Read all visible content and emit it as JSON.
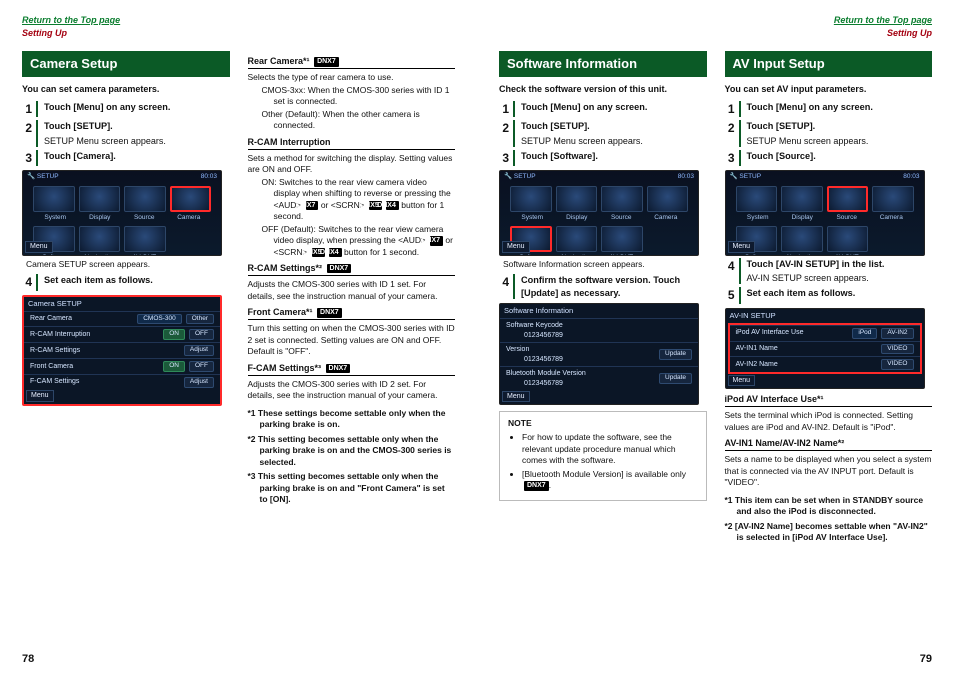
{
  "top": {
    "return_link": "Return to the Top page",
    "section": "Setting Up"
  },
  "page78": {
    "num": "78"
  },
  "page79": {
    "num": "79"
  },
  "screen_labels": {
    "system": "System",
    "display": "Display",
    "source": "Source",
    "camera": "Camera",
    "software": "Software",
    "navigation": "Navigation",
    "avout": "AV-OUT",
    "setup_tag": "SETUP",
    "menu": "Menu",
    "time": "80:03"
  },
  "camera": {
    "title": "Camera Setup",
    "lead": "You can set camera parameters.",
    "s1": "Touch [Menu] on any screen.",
    "s2": "Touch [SETUP].",
    "s2d": "SETUP Menu screen appears.",
    "s3": "Touch [Camera].",
    "cap1": "Camera SETUP screen appears.",
    "s4": "Set each item as follows.",
    "list": {
      "title": "Camera SETUP",
      "r1": "Rear Camera",
      "r1a": "CMOS-300",
      "r1b": "Other",
      "r2": "R-CAM Interruption",
      "r2a": "ON",
      "r2b": "OFF",
      "r3": "R-CAM Settings",
      "r3a": "Adjust",
      "r4": "Front Camera",
      "r4a": "ON",
      "r4b": "OFF",
      "r5": "F-CAM Settings",
      "r5a": "Adjust"
    }
  },
  "camera_defs": {
    "d1h": "Rear Camera*¹",
    "d1": "Selects the type of rear camera to use.",
    "d1a": "CMOS-3xx",
    "d1at": "When the CMOS-300 series with ID 1 set is connected.",
    "d1b": "Other (Default)",
    "d1bt": "When the other camera is connected.",
    "d2h": "R-CAM Interruption",
    "d2": "Sets a method for switching the display. Setting values are ON and OFF.",
    "d2a": "ON",
    "d2at": "Switches to the rear view camera video display when shifting to reverse or pressing the <AUD>",
    "d2at2": "or <SCRN>",
    "d2at3": "button for 1 second.",
    "d2b": "OFF (Default)",
    "d2bt": "Switches to the rear view camera video display, when pressing the <AUD>",
    "d2bt2": "or <SCRN>",
    "d2bt3": "button for 1 second.",
    "d3h": "R-CAM Settings*²",
    "d3": "Adjusts the CMOS-300 series with ID 1 set. For details, see the instruction manual of your camera.",
    "d4h": "Front Camera*¹",
    "d4": "Turn this setting on when the CMOS-300 series with ID 2 set is connected. Setting values are ON and OFF. Default is \"OFF\".",
    "d5h": "F-CAM Settings*³",
    "d5": "Adjusts the CMOS-300 series with ID 2 set. For details, see the instruction manual of your camera.",
    "foot1": "*1 These settings become settable only when the parking brake is on.",
    "foot2": "*2 This setting becomes settable only when the parking brake is on and the CMOS-300 series is selected.",
    "foot3": "*3 This setting becomes settable only when the parking brake is on and \"Front Camera\" is set to [ON].",
    "badge7": "DNX7",
    "badge5": "DNX5",
    "badge4": "DNX4"
  },
  "sw": {
    "title": "Software Information",
    "lead": "Check the software version of this unit.",
    "s1": "Touch [Menu] on any screen.",
    "s2": "Touch [SETUP].",
    "s2d": "SETUP Menu screen appears.",
    "s3": "Touch [Software].",
    "cap1": "Software Information screen appears.",
    "s4": "Confirm the software version. Touch [Update] as necessary.",
    "list": {
      "title": "Software Information",
      "r1": "Software Keycode",
      "r1v": "0123456789",
      "r2": "Version",
      "r2v": "0123456789",
      "upd": "Update",
      "r3": "Bluetooth Module Version",
      "r3v": "0123456789"
    },
    "note_label": "NOTE",
    "note1": "For how to update the software, see the relevant update procedure manual which comes with the software.",
    "note2": "[Bluetooth Module Version] is available only"
  },
  "av": {
    "title": "AV Input Setup",
    "lead": "You can set AV input parameters.",
    "s1": "Touch [Menu] on any screen.",
    "s2": "Touch [SETUP].",
    "s2d": "SETUP Menu screen appears.",
    "s3": "Touch [Source].",
    "s4": "Touch [AV-IN SETUP] in the list.",
    "s4d": "AV-IN SETUP screen appears.",
    "s5": "Set each item as follows.",
    "list": {
      "title": "AV-IN SETUP",
      "r1": "iPod AV Interface Use",
      "r1a": "iPod",
      "r1b": "AV-IN2",
      "r2": "AV-IN1 Name",
      "r2a": "VIDEO",
      "r3": "AV-IN2 Name",
      "r3a": "VIDEO"
    },
    "d1h": "iPod AV Interface Use*¹",
    "d1": "Sets the terminal which iPod is connected. Setting values are iPod and AV-IN2. Default is \"iPod\".",
    "d2h": "AV-IN1 Name/AV-IN2 Name*²",
    "d2": "Sets a name to be displayed when you select a system that is connected via the AV INPUT port. Default is \"VIDEO\".",
    "foot1": "*1 This item can be set when in STANDBY source and also the iPod is disconnected.",
    "foot2": "*2 [AV-IN2 Name] becomes settable when \"AV-IN2\" is selected in [iPod AV Interface Use]."
  }
}
